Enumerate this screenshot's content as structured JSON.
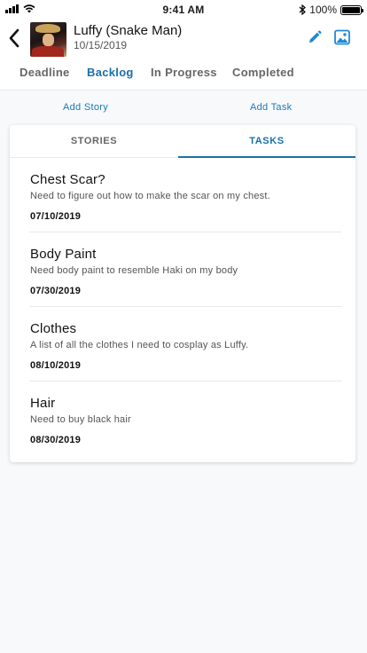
{
  "status_bar": {
    "time": "9:41 AM",
    "battery": "100%"
  },
  "header": {
    "title": "Luffy (Snake Man)",
    "date": "10/15/2019"
  },
  "status_tabs": [
    {
      "label": "Deadline",
      "active": false
    },
    {
      "label": "Backlog",
      "active": true
    },
    {
      "label": "In Progress",
      "active": false
    },
    {
      "label": "Completed",
      "active": false
    }
  ],
  "actions": {
    "add_story": "Add Story",
    "add_task": "Add Task"
  },
  "inner_tabs": {
    "stories": "STORIES",
    "tasks": "TASKS",
    "active": "tasks"
  },
  "tasks": [
    {
      "title": "Chest Scar?",
      "description": "Need to figure out how to make the scar on my chest.",
      "date": "07/10/2019"
    },
    {
      "title": "Body Paint",
      "description": "Need body paint to resemble Haki on my body",
      "date": "07/30/2019"
    },
    {
      "title": "Clothes",
      "description": "A list of all the clothes I need to cosplay as Luffy.",
      "date": "08/10/2019"
    },
    {
      "title": "Hair",
      "description": "Need to buy black hair",
      "date": "08/30/2019"
    }
  ],
  "colors": {
    "accent": "#1a6fa8",
    "link": "#1a7ab5",
    "icon_blue": "#1e8ad6"
  }
}
